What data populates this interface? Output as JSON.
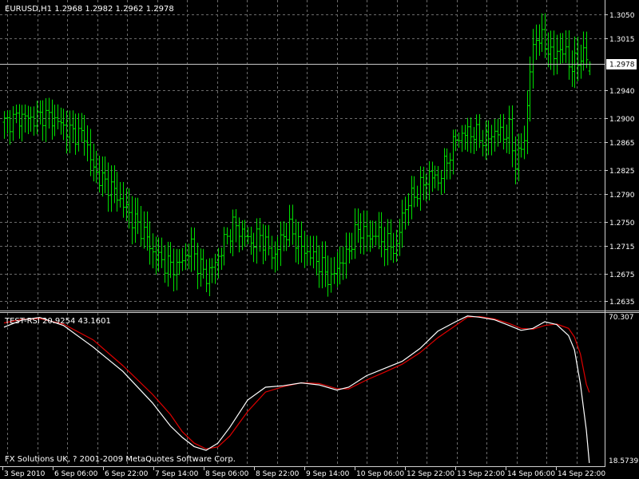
{
  "main_panel": {
    "header": "EURUSD,H1  1.2968 1.2982 1.2962 1.2978",
    "price_ticks": [
      "1.3050",
      "1.3015",
      "1.2940",
      "1.2900",
      "1.2865",
      "1.2825",
      "1.2790",
      "1.2750",
      "1.2715",
      "1.2675",
      "1.2635"
    ],
    "current_price_label": "1.2978"
  },
  "indicator_panel": {
    "header": "TEST-RSI 20.9254 43.1601",
    "max_label": "70.307",
    "min_label": "18.5739",
    "copyright": "FX Solutions UK, ? 2001-2009 MetaQuotes Software Corp."
  },
  "time_axis": {
    "labels": [
      "3 Sep 2010",
      "6 Sep 06:00",
      "6 Sep 22:00",
      "7 Sep 14:00",
      "8 Sep 06:00",
      "8 Sep 22:00",
      "9 Sep 14:00",
      "10 Sep 06:00",
      "12 Sep 22:00",
      "13 Sep 22:00",
      "14 Sep 06:00",
      "14 Sep 22:00"
    ]
  },
  "colors": {
    "background": "#000000",
    "grid": "#6b6b6b",
    "bars": "#00e000",
    "text": "#ffffff",
    "rsi_main": "#ffffff",
    "rsi_signal": "#e00000",
    "price_line": "#c8c8c8"
  },
  "chart_data": [
    {
      "type": "ohlc",
      "symbol": "EURUSD",
      "timeframe": "H1",
      "ylim": [
        1.2624,
        1.3066
      ],
      "current_price": 1.2978,
      "last_bar": {
        "open": 1.2968,
        "high": 1.2982,
        "low": 1.2962,
        "close": 1.2978
      },
      "close_path": [
        [
          0,
          1.2893
        ],
        [
          6,
          1.2902
        ],
        [
          10,
          1.2898
        ],
        [
          13,
          1.2905
        ],
        [
          18,
          1.2895
        ],
        [
          22,
          1.288
        ],
        [
          27,
          1.2875
        ],
        [
          30,
          1.2825
        ],
        [
          33,
          1.281
        ],
        [
          36,
          1.28
        ],
        [
          40,
          1.2775
        ],
        [
          43,
          1.2755
        ],
        [
          47,
          1.2735
        ],
        [
          50,
          1.2705
        ],
        [
          54,
          1.269
        ],
        [
          58,
          1.2685
        ],
        [
          61,
          1.27
        ],
        [
          63,
          1.2715
        ],
        [
          65,
          1.269
        ],
        [
          68,
          1.2672
        ],
        [
          71,
          1.269
        ],
        [
          74,
          1.272
        ],
        [
          77,
          1.2745
        ],
        [
          80,
          1.2735
        ],
        [
          83,
          1.272
        ],
        [
          86,
          1.273
        ],
        [
          89,
          1.271
        ],
        [
          91,
          1.27
        ],
        [
          93,
          1.2725
        ],
        [
          96,
          1.274
        ],
        [
          99,
          1.2718
        ],
        [
          102,
          1.2705
        ],
        [
          105,
          1.2695
        ],
        [
          108,
          1.2678
        ],
        [
          110,
          1.2665
        ],
        [
          112,
          1.2685
        ],
        [
          115,
          1.27
        ],
        [
          117,
          1.2722
        ],
        [
          119,
          1.274
        ],
        [
          121,
          1.2735
        ],
        [
          123,
          1.2725
        ],
        [
          125,
          1.2735
        ],
        [
          127,
          1.2725
        ],
        [
          130,
          1.2715
        ],
        [
          132,
          1.2712
        ],
        [
          134,
          1.276
        ],
        [
          136,
          1.278
        ],
        [
          138,
          1.279
        ],
        [
          141,
          1.2805
        ],
        [
          143,
          1.2818
        ],
        [
          146,
          1.281
        ],
        [
          149,
          1.284
        ],
        [
          152,
          1.287
        ],
        [
          156,
          1.288
        ],
        [
          159,
          1.2875
        ],
        [
          162,
          1.2868
        ],
        [
          165,
          1.288
        ],
        [
          168,
          1.2876
        ],
        [
          170,
          1.2882
        ],
        [
          172,
          1.2835
        ],
        [
          175,
          1.2868
        ],
        [
          177,
          1.297
        ],
        [
          179,
          1.302
        ],
        [
          181,
          1.3012
        ],
        [
          183,
          1.3
        ],
        [
          185,
          1.2988
        ],
        [
          187,
          1.3002
        ],
        [
          189,
          1.299
        ],
        [
          191,
          1.2975
        ],
        [
          193,
          1.2982
        ],
        [
          195,
          1.2995
        ],
        [
          197,
          1.2978
        ]
      ]
    },
    {
      "type": "line",
      "name": "TEST-RSI",
      "ylim": [
        18.5739,
        70.307
      ],
      "values_shown": [
        20.9254,
        43.1601
      ],
      "series": [
        {
          "color": "#ffffff",
          "points": [
            [
              0,
              65.9
            ],
            [
              6,
              68.4
            ],
            [
              12,
              69.3
            ],
            [
              20,
              66.5
            ],
            [
              30,
              59.0
            ],
            [
              40,
              50.5
            ],
            [
              50,
              39.5
            ],
            [
              56,
              31.5
            ],
            [
              60,
              27.5
            ],
            [
              64,
              24.3
            ],
            [
              68,
              23.0
            ],
            [
              72,
              25.5
            ],
            [
              76,
              31.0
            ],
            [
              82,
              40.5
            ],
            [
              88,
              45.0
            ],
            [
              94,
              45.5
            ],
            [
              100,
              46.5
            ],
            [
              106,
              45.8
            ],
            [
              112,
              44.0
            ],
            [
              116,
              45.0
            ],
            [
              122,
              49.0
            ],
            [
              128,
              51.5
            ],
            [
              134,
              54.0
            ],
            [
              140,
              58.5
            ],
            [
              146,
              64.5
            ],
            [
              152,
              67.8
            ],
            [
              156,
              69.8
            ],
            [
              160,
              69.4
            ],
            [
              165,
              68.5
            ],
            [
              170,
              66.5
            ],
            [
              174,
              64.8
            ],
            [
              178,
              65.5
            ],
            [
              182,
              67.8
            ],
            [
              186,
              66.8
            ],
            [
              190,
              63.0
            ],
            [
              192,
              58.0
            ],
            [
              194,
              46.0
            ],
            [
              196,
              30.0
            ],
            [
              197,
              18.6
            ]
          ]
        },
        {
          "color": "#e00000",
          "points": [
            [
              0,
              67.4
            ],
            [
              6,
              68.6
            ],
            [
              12,
              68.9
            ],
            [
              20,
              67.0
            ],
            [
              30,
              61.5
            ],
            [
              40,
              52.5
            ],
            [
              50,
              42.5
            ],
            [
              56,
              35.5
            ],
            [
              60,
              29.5
            ],
            [
              64,
              25.5
            ],
            [
              68,
              23.5
            ],
            [
              72,
              24.2
            ],
            [
              76,
              28.0
            ],
            [
              82,
              36.5
            ],
            [
              88,
              43.3
            ],
            [
              94,
              45.2
            ],
            [
              100,
              46.5
            ],
            [
              106,
              46.3
            ],
            [
              112,
              44.5
            ],
            [
              116,
              44.4
            ],
            [
              122,
              47.5
            ],
            [
              128,
              50.2
            ],
            [
              134,
              53.0
            ],
            [
              140,
              57.0
            ],
            [
              146,
              62.2
            ],
            [
              152,
              66.5
            ],
            [
              156,
              69.4
            ],
            [
              160,
              69.6
            ],
            [
              165,
              68.8
            ],
            [
              170,
              67.2
            ],
            [
              174,
              65.5
            ],
            [
              178,
              65.2
            ],
            [
              182,
              66.5
            ],
            [
              186,
              67.0
            ],
            [
              190,
              65.5
            ],
            [
              192,
              62.5
            ],
            [
              194,
              56.5
            ],
            [
              196,
              46.0
            ],
            [
              197,
              43.2
            ]
          ]
        }
      ]
    }
  ]
}
